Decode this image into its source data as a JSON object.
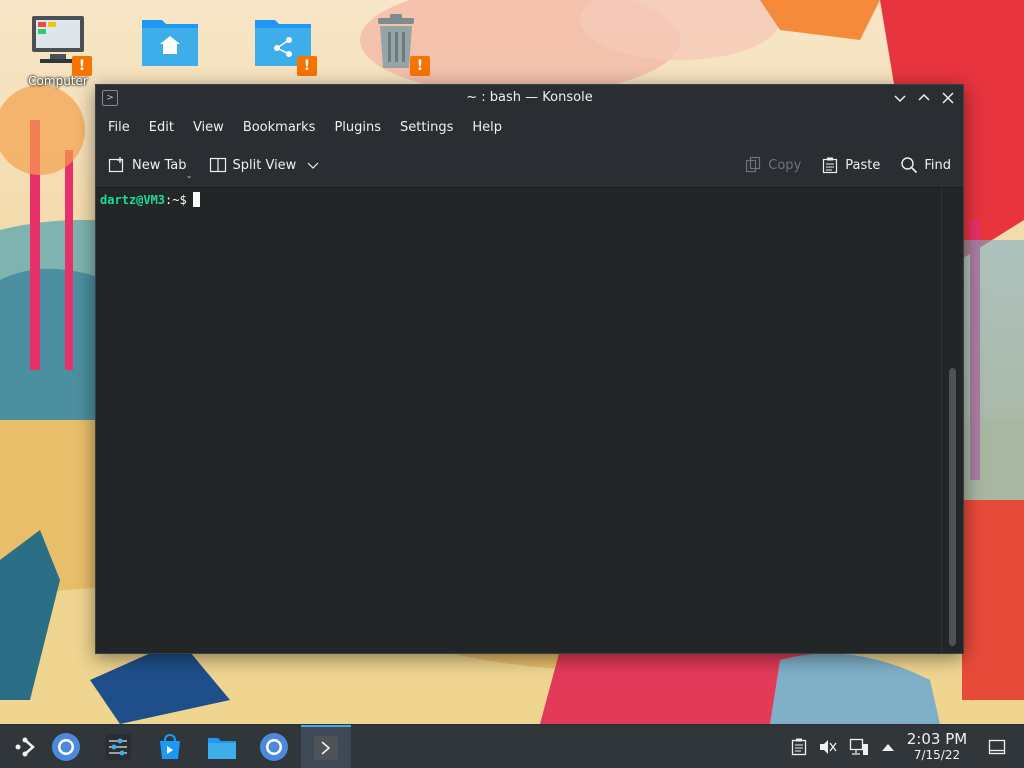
{
  "desktop": {
    "icons": [
      {
        "label": "Computer",
        "icon": "computer-icon"
      },
      {
        "label": "",
        "icon": "home-folder-icon"
      },
      {
        "label": "",
        "icon": "network-folder-icon"
      },
      {
        "label": "",
        "icon": "trash-icon"
      }
    ]
  },
  "window": {
    "title": "~ : bash — Konsole",
    "menu": [
      "File",
      "Edit",
      "View",
      "Bookmarks",
      "Plugins",
      "Settings",
      "Help"
    ],
    "toolbar": {
      "new_tab": "New Tab",
      "split_view": "Split View",
      "copy": "Copy",
      "paste": "Paste",
      "find": "Find"
    },
    "terminal": {
      "prompt_user": "dartz@VM3",
      "prompt_rest": ":~$"
    }
  },
  "taskbar": {
    "time": "2:03 PM",
    "date": "7/15/22",
    "tasks": [
      "application-launcher-icon",
      "chromium-icon",
      "system-settings-icon",
      "discover-icon",
      "dolphin-icon",
      "chromium-icon",
      "konsole-icon"
    ],
    "tray": [
      "clipboard-icon",
      "volume-muted-icon",
      "network-icon",
      "expand-tray-icon",
      "show-desktop-icon"
    ]
  },
  "colors": {
    "accent": "#3daee9",
    "warning": "#f67400",
    "prompt_user": "#1cdc9a"
  }
}
